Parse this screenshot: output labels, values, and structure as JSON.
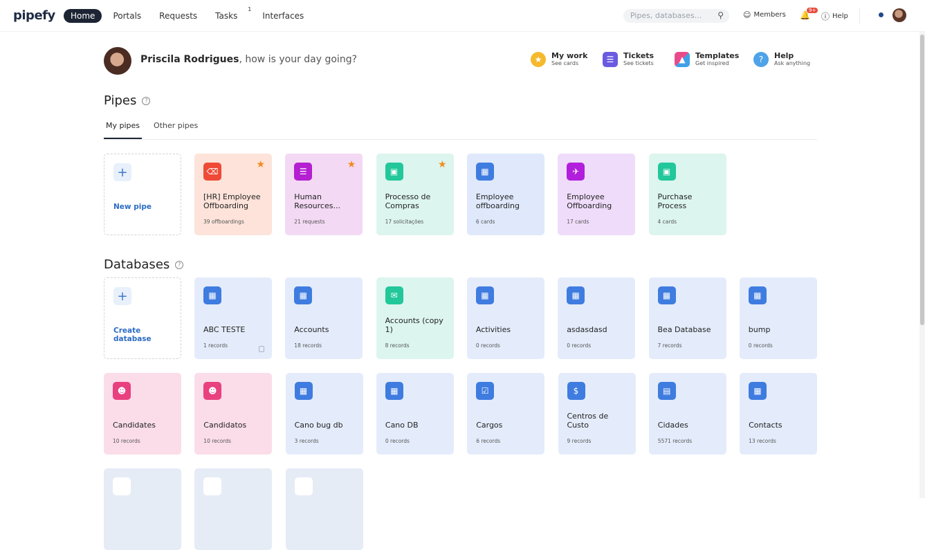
{
  "app": {
    "logo": "pipefy"
  },
  "nav": {
    "items": [
      {
        "label": "Home",
        "active": true
      },
      {
        "label": "Portals",
        "active": false
      },
      {
        "label": "Requests",
        "active": false
      },
      {
        "label": "Tasks",
        "active": false,
        "badge": "1"
      },
      {
        "label": "Interfaces",
        "active": false
      }
    ],
    "search_placeholder": "Pipes, databases...",
    "members_label": "Members",
    "notifications_badge": "9+",
    "help_label": "Help"
  },
  "greeting": {
    "name": "Priscila Rodrigues",
    "text": ", how is your day going?"
  },
  "quick_links": [
    {
      "title": "My work",
      "subtitle": "See cards",
      "icon": "medal-icon",
      "color": "#f5b92e"
    },
    {
      "title": "Tickets",
      "subtitle": "See tickets",
      "icon": "list-icon",
      "color": "#6a5ae0"
    },
    {
      "title": "Templates",
      "subtitle": "Get inspired",
      "icon": "shapes-icon",
      "color": "#e94b8a"
    },
    {
      "title": "Help",
      "subtitle": "Ask anything",
      "icon": "question-bubble-icon",
      "color": "#4fa3e8"
    }
  ],
  "pipes": {
    "title": "Pipes",
    "tabs": [
      "My pipes",
      "Other pipes"
    ],
    "new_label": "New pipe",
    "cards": [
      {
        "name": "[HR] Employee Offboarding",
        "count": "39 offboardings",
        "bg": "#fde3da",
        "icon_color": "#ee4a37",
        "starred": true,
        "icon": "trash-icon"
      },
      {
        "name": "Human Resources...",
        "count": "21 requests",
        "bg": "#f3d9f3",
        "icon_color": "#b41fd1",
        "starred": true,
        "icon": "document-icon"
      },
      {
        "name": "Processo de Compras",
        "count": "17 solicitações",
        "bg": "#dcf5ee",
        "icon_color": "#22c79a",
        "starred": true,
        "icon": "cart-icon"
      },
      {
        "name": "Employee offboarding",
        "count": "6 cards",
        "bg": "#dfe9fb",
        "icon_color": "#3f7ce0",
        "starred": false,
        "icon": "board-icon"
      },
      {
        "name": "Employee Offboarding",
        "count": "17 cards",
        "bg": "#efdcfa",
        "icon_color": "#b21fdc",
        "starred": false,
        "icon": "plane-icon"
      },
      {
        "name": "Purchase Process",
        "count": "4 cards",
        "bg": "#dcf5ee",
        "icon_color": "#22c79a",
        "starred": false,
        "icon": "cart-icon"
      }
    ]
  },
  "databases": {
    "title": "Databases",
    "new_label": "Create database",
    "row1": [
      {
        "name": "ABC TESTE",
        "count": "1 records",
        "bg": "#e4ecfb",
        "icon_color": "#3f7ce0",
        "icon": "board-icon",
        "locked": true
      },
      {
        "name": "Accounts",
        "count": "18 records",
        "bg": "#e4ecfb",
        "icon_color": "#3f7ce0",
        "icon": "board-icon"
      },
      {
        "name": "Accounts (copy 1)",
        "count": "8 records",
        "bg": "#dcf5ee",
        "icon_color": "#22c79a",
        "icon": "chat-icon"
      },
      {
        "name": "Activities",
        "count": "0 records",
        "bg": "#e4ecfb",
        "icon_color": "#3f7ce0",
        "icon": "board-icon"
      },
      {
        "name": "asdasdasd",
        "count": "0 records",
        "bg": "#e4ecfb",
        "icon_color": "#3f7ce0",
        "icon": "board-icon"
      },
      {
        "name": "Bea Database",
        "count": "7 records",
        "bg": "#e4ecfb",
        "icon_color": "#3f7ce0",
        "icon": "board-icon"
      },
      {
        "name": "bump",
        "count": "0 records",
        "bg": "#e4ecfb",
        "icon_color": "#3f7ce0",
        "icon": "board-icon"
      }
    ],
    "row2": [
      {
        "name": "Candidates",
        "count": "10 records",
        "bg": "#fbdde9",
        "icon_color": "#e9407f",
        "icon": "user-group-icon"
      },
      {
        "name": "Candidatos",
        "count": "10 records",
        "bg": "#fbdde9",
        "icon_color": "#e9407f",
        "icon": "user-group-icon"
      },
      {
        "name": "Cano bug db",
        "count": "3 records",
        "bg": "#e4ecfb",
        "icon_color": "#3f7ce0",
        "icon": "board-icon"
      },
      {
        "name": "Cano DB",
        "count": "0 records",
        "bg": "#e4ecfb",
        "icon_color": "#3f7ce0",
        "icon": "board-icon"
      },
      {
        "name": "Cargos",
        "count": "6 records",
        "bg": "#e4ecfb",
        "icon_color": "#3f7ce0",
        "icon": "badge-icon"
      },
      {
        "name": "Centros de Custo",
        "count": "9 records",
        "bg": "#e4ecfb",
        "icon_color": "#3f7ce0",
        "icon": "money-icon"
      },
      {
        "name": "Cidades",
        "count": "5571 records",
        "bg": "#e4ecfb",
        "icon_color": "#3f7ce0",
        "icon": "chart-icon"
      },
      {
        "name": "Contacts",
        "count": "13 records",
        "bg": "#e4ecfb",
        "icon_color": "#3f7ce0",
        "icon": "board-icon"
      }
    ],
    "row3_count": 3
  }
}
